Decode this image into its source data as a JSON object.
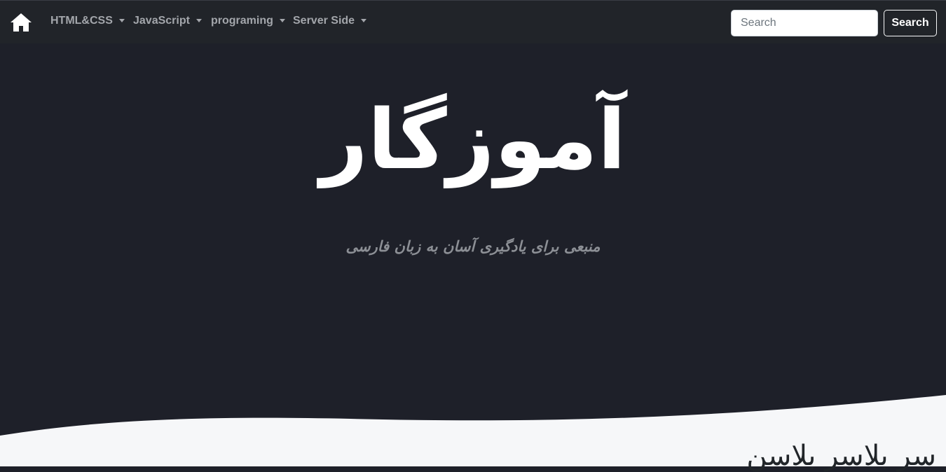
{
  "navbar": {
    "home_icon": "home-icon",
    "items": [
      {
        "label": "HTML&CSS"
      },
      {
        "label": "JavaScript"
      },
      {
        "label": "programing"
      },
      {
        "label": "Server Side"
      }
    ],
    "search": {
      "placeholder": "Search",
      "value": "",
      "button_label": "Search"
    }
  },
  "hero": {
    "title": "آموزگار",
    "subtitle": "منبعی برای یادگیری آسان به زبان فارسی"
  },
  "section": {
    "heading": "سر بلاسر بلاسن"
  },
  "colors": {
    "navbar_bg": "#212429",
    "hero_bg": "#1e2029",
    "content_bg": "#f6f7f9",
    "nav_text": "#a3a6ab",
    "title_text": "#ffffff",
    "subtitle_text": "#8c8f95"
  }
}
